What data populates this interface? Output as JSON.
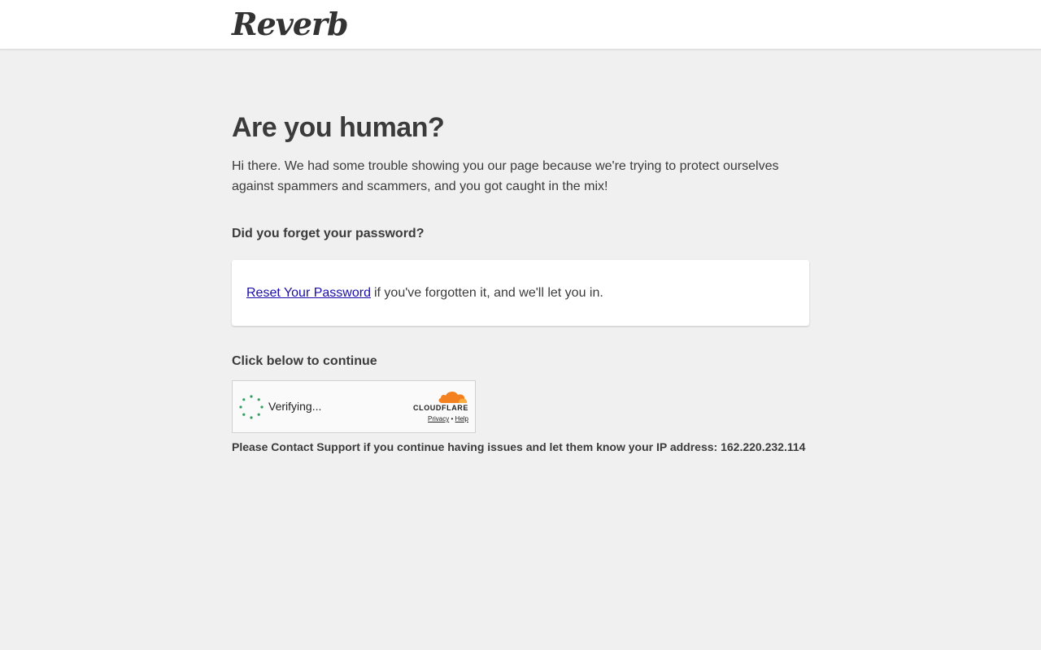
{
  "header": {
    "logo_text": "Reverb"
  },
  "main": {
    "title": "Are you human?",
    "intro": "Hi there. We had some trouble showing you our page because we're trying to protect ourselves against spammers and scammers, and you got caught in the mix!",
    "forgot_heading": "Did you forget your password?",
    "reset_link": "Reset Your Password",
    "reset_rest": "if you've forgotten it, and we'll let you in.",
    "continue_heading": "Click below to continue",
    "support_text": "Please Contact Support if you continue having issues and let them know your IP address: 162.220.232.114"
  },
  "captcha": {
    "status": "Verifying...",
    "brand": "CLOUDFLARE",
    "privacy_label": "Privacy",
    "separator": "•",
    "help_label": "Help"
  },
  "colors": {
    "background": "#f0f0f0",
    "link": "#1a0dab",
    "text": "#3b3b3b",
    "spinner": "#2f9e5e",
    "cloudflare_orange": "#f48120"
  },
  "icons": {
    "spinner": "loading-spinner-icon",
    "cloud": "cloudflare-cloud-icon"
  }
}
